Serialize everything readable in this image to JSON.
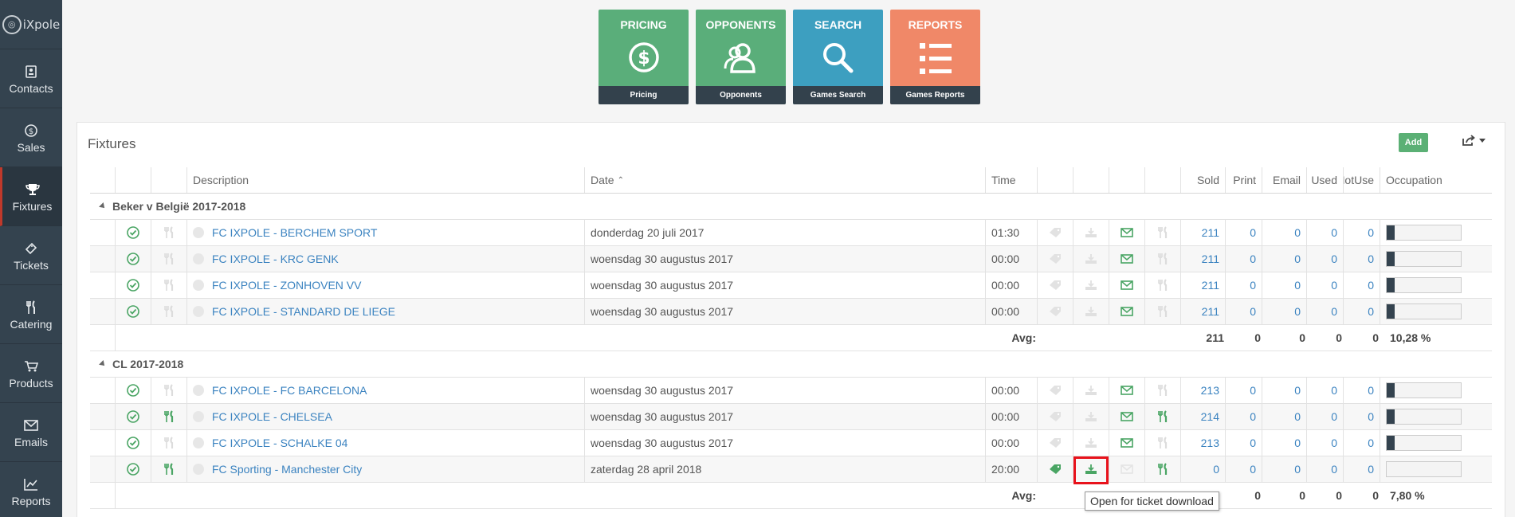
{
  "app": {
    "logo_text": "iXpole"
  },
  "sidebar": {
    "items": [
      {
        "label": "Contacts",
        "icon": "contacts-icon"
      },
      {
        "label": "Sales",
        "icon": "dollar-icon"
      },
      {
        "label": "Fixtures",
        "icon": "trophy-icon",
        "active": true
      },
      {
        "label": "Tickets",
        "icon": "ticket-icon"
      },
      {
        "label": "Catering",
        "icon": "fork-knife-icon"
      },
      {
        "label": "Products",
        "icon": "cart-icon"
      },
      {
        "label": "Emails",
        "icon": "envelope-icon"
      },
      {
        "label": "Reports",
        "icon": "chart-icon"
      }
    ]
  },
  "tiles": [
    {
      "title": "PRICING",
      "footer": "Pricing",
      "color": "#5aae7a",
      "icon": "dollar-circle-icon"
    },
    {
      "title": "OPPONENTS",
      "footer": "Opponents",
      "color": "#5aae7a",
      "icon": "users-icon"
    },
    {
      "title": "SEARCH",
      "footer": "Games Search",
      "color": "#3d9fc0",
      "icon": "search-icon"
    },
    {
      "title": "REPORTS",
      "footer": "Games Reports",
      "color": "#f08868",
      "icon": "list-icon"
    }
  ],
  "panel": {
    "title": "Fixtures",
    "add_label": "Add"
  },
  "table": {
    "headers": {
      "description": "Description",
      "date": "Date",
      "time": "Time",
      "sold": "Sold",
      "print": "Print",
      "email": "Email",
      "used": "Used",
      "notuse": "NotUse",
      "occupation": "Occupation"
    },
    "groups": [
      {
        "name": "Beker v België 2017-2018",
        "rows": [
          {
            "desc": "FC IXPOLE - BERCHEM SPORT",
            "date": "donderdag 20 juli 2017",
            "time": "01:30",
            "sold": "211",
            "print": "0",
            "email": "0",
            "used": "0",
            "notuse": "0",
            "occ_pct": 10.28
          },
          {
            "desc": "FC IXPOLE - KRC GENK",
            "date": "woensdag 30 augustus 2017",
            "time": "00:00",
            "sold": "211",
            "print": "0",
            "email": "0",
            "used": "0",
            "notuse": "0",
            "occ_pct": 10.28
          },
          {
            "desc": "FC IXPOLE - ZONHOVEN VV",
            "date": "woensdag 30 augustus 2017",
            "time": "00:00",
            "sold": "211",
            "print": "0",
            "email": "0",
            "used": "0",
            "notuse": "0",
            "occ_pct": 10.28
          },
          {
            "desc": "FC IXPOLE - STANDARD DE LIEGE",
            "date": "woensdag 30 augustus 2017",
            "time": "00:00",
            "sold": "211",
            "print": "0",
            "email": "0",
            "used": "0",
            "notuse": "0",
            "occ_pct": 10.28
          }
        ],
        "avg": {
          "label": "Avg:",
          "sold": "211",
          "print": "0",
          "email": "0",
          "used": "0",
          "notuse": "0",
          "occupation": "10,28 %"
        }
      },
      {
        "name": "CL 2017-2018",
        "rows": [
          {
            "desc": "FC IXPOLE - FC BARCELONA",
            "date": "woensdag 30 augustus 2017",
            "time": "00:00",
            "sold": "213",
            "print": "0",
            "email": "0",
            "used": "0",
            "notuse": "0",
            "occ_pct": 10.38
          },
          {
            "desc": "FC IXPOLE - CHELSEA",
            "date": "woensdag 30 augustus 2017",
            "time": "00:00",
            "sold": "214",
            "print": "0",
            "email": "0",
            "used": "0",
            "notuse": "0",
            "occ_pct": 10.43,
            "catering": true
          },
          {
            "desc": "FC IXPOLE - SCHALKE 04",
            "date": "woensdag 30 augustus 2017",
            "time": "00:00",
            "sold": "213",
            "print": "0",
            "email": "0",
            "used": "0",
            "notuse": "0",
            "occ_pct": 10.38
          },
          {
            "desc": "FC Sporting - Manchester City",
            "date": "zaterdag 28 april 2018",
            "time": "20:00",
            "sold": "0",
            "print": "0",
            "email": "0",
            "used": "0",
            "notuse": "0",
            "occ_pct": 0,
            "catering": true,
            "tagged": true,
            "download_open": true
          }
        ],
        "avg": {
          "label": "Avg:",
          "sold": "",
          "print": "0",
          "email": "0",
          "used": "0",
          "notuse": "0",
          "occupation": "7,80 %"
        }
      }
    ]
  },
  "tooltip": {
    "text": "Open for ticket download"
  },
  "colors": {
    "sidebar": "#34434f",
    "green": "#5bb075",
    "link": "#3b83c0",
    "highlight": "#e8121b"
  }
}
